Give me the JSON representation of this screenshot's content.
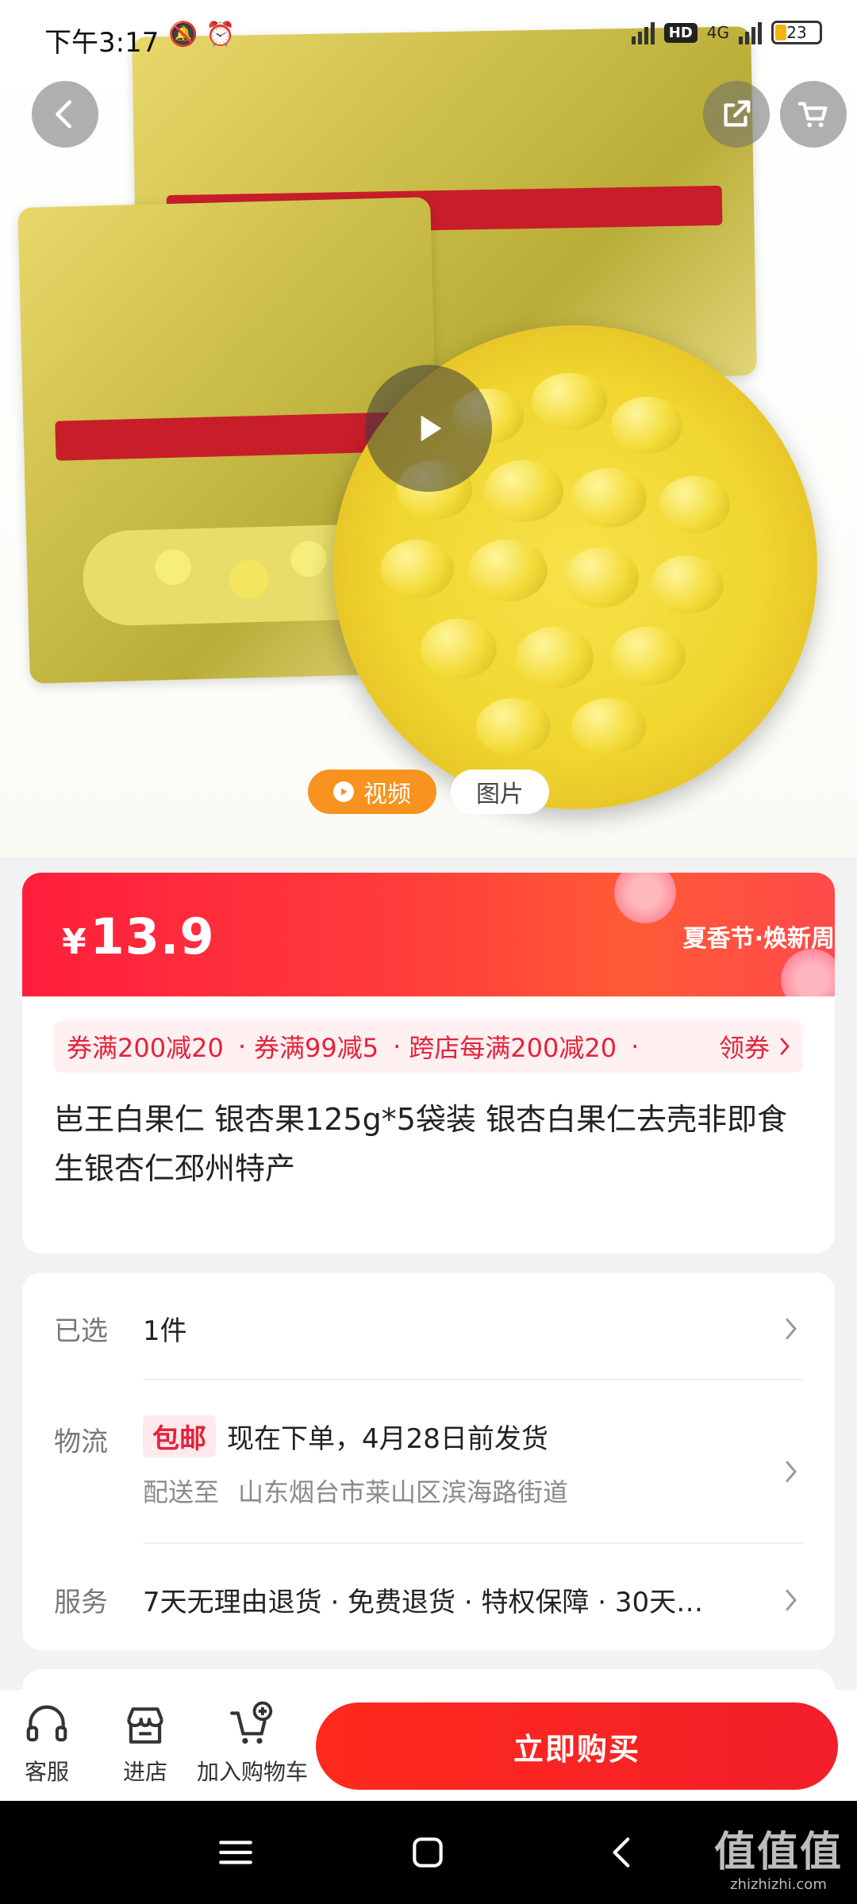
{
  "status_bar": {
    "time": "下午3:17",
    "battery": "23",
    "network": "4G",
    "hd_label": "HD"
  },
  "hero": {
    "media_tabs": [
      "视频",
      "图片"
    ],
    "active_tab": "视频"
  },
  "price_banner": {
    "currency": "¥",
    "price": "13.9",
    "promo_text": "夏香节·焕新周"
  },
  "coupons": {
    "items": [
      "券满200减20",
      "券满99减5",
      "跨店每满200减20"
    ],
    "separator": "·",
    "get_label": "领券"
  },
  "product": {
    "title": "岜王白果仁 银杏果125g*5袋装 银杏白果仁去壳非即食生银杏仁邳州特产"
  },
  "details": {
    "selected_label": "已选",
    "selected_value": "1件",
    "shipping_label": "物流",
    "shipping_badge": "包邮",
    "shipping_text": "现在下单，4月28日前发货",
    "deliver_to_label": "配送至",
    "deliver_to_address": "山东烟台市莱山区滨海路街道",
    "service_label": "服务",
    "service_value": "7天无理由退货 · 免费退货 · 特权保障 · 30天…"
  },
  "action_bar": {
    "customer_service": "客服",
    "store": "进店",
    "add_to_cart": "加入购物车",
    "buy_now": "立即购买"
  },
  "watermark": {
    "brand": "值值值",
    "site": "zhizhizhi.com"
  },
  "colors": {
    "accent_red": "#ff1e3c",
    "video_orange": "#f7931e",
    "coupon_red": "#e4233a"
  }
}
